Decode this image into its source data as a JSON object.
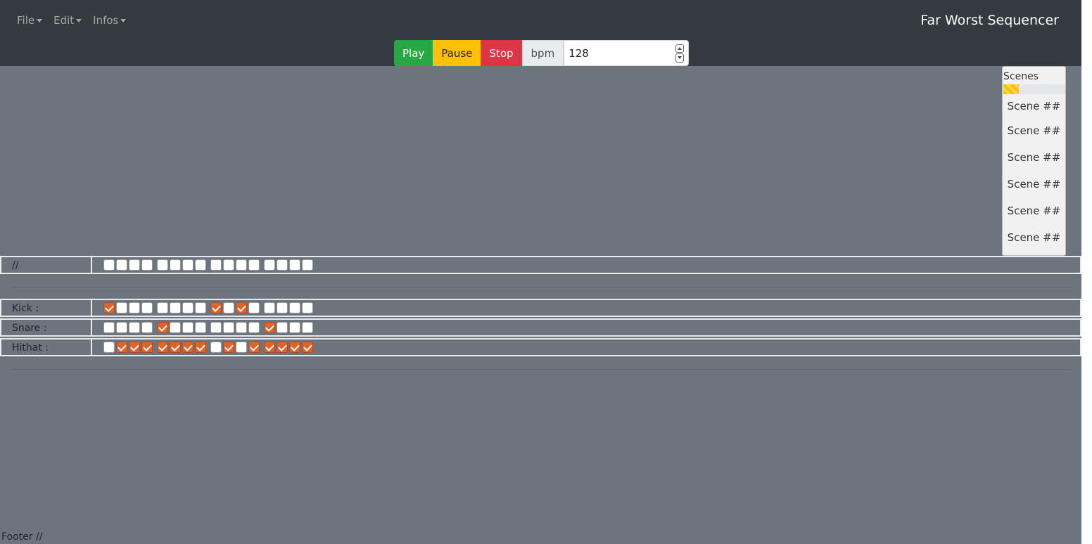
{
  "navbar": {
    "menus": [
      {
        "label": "File"
      },
      {
        "label": "Edit"
      },
      {
        "label": "Infos"
      }
    ],
    "brand": "Far Worst Sequencer"
  },
  "transport": {
    "play_label": "Play",
    "pause_label": "Pause",
    "stop_label": "Stop",
    "bpm_label": "bpm",
    "bpm_value": "128"
  },
  "scenes": {
    "title": "Scenes",
    "progress": 0.25,
    "items": [
      "Scene ##",
      "Scene ##",
      "Scene ##",
      "Scene ##",
      "Scene ##",
      "Scene ##"
    ]
  },
  "tracks": {
    "header": {
      "label": "//",
      "steps": [
        0,
        0,
        0,
        0,
        0,
        0,
        0,
        0,
        0,
        0,
        0,
        0,
        0,
        0,
        0,
        0
      ]
    },
    "instruments": [
      {
        "label": "Kick :",
        "steps": [
          1,
          0,
          0,
          0,
          0,
          0,
          0,
          0,
          1,
          0,
          1,
          0,
          0,
          0,
          0,
          0
        ]
      },
      {
        "label": "Snare :",
        "steps": [
          0,
          0,
          0,
          0,
          1,
          0,
          0,
          0,
          0,
          0,
          0,
          0,
          1,
          0,
          0,
          0
        ]
      },
      {
        "label": "Hithat :",
        "steps": [
          0,
          1,
          1,
          1,
          1,
          1,
          1,
          1,
          0,
          1,
          0,
          1,
          1,
          1,
          1,
          1
        ]
      }
    ]
  },
  "footer": {
    "text": "Footer //"
  },
  "colors": {
    "navbar": "#343a40",
    "main_bg": "#6c757d",
    "play": "#28a745",
    "pause": "#ffc107",
    "stop": "#dc3545",
    "step_on": "#e0642a"
  }
}
